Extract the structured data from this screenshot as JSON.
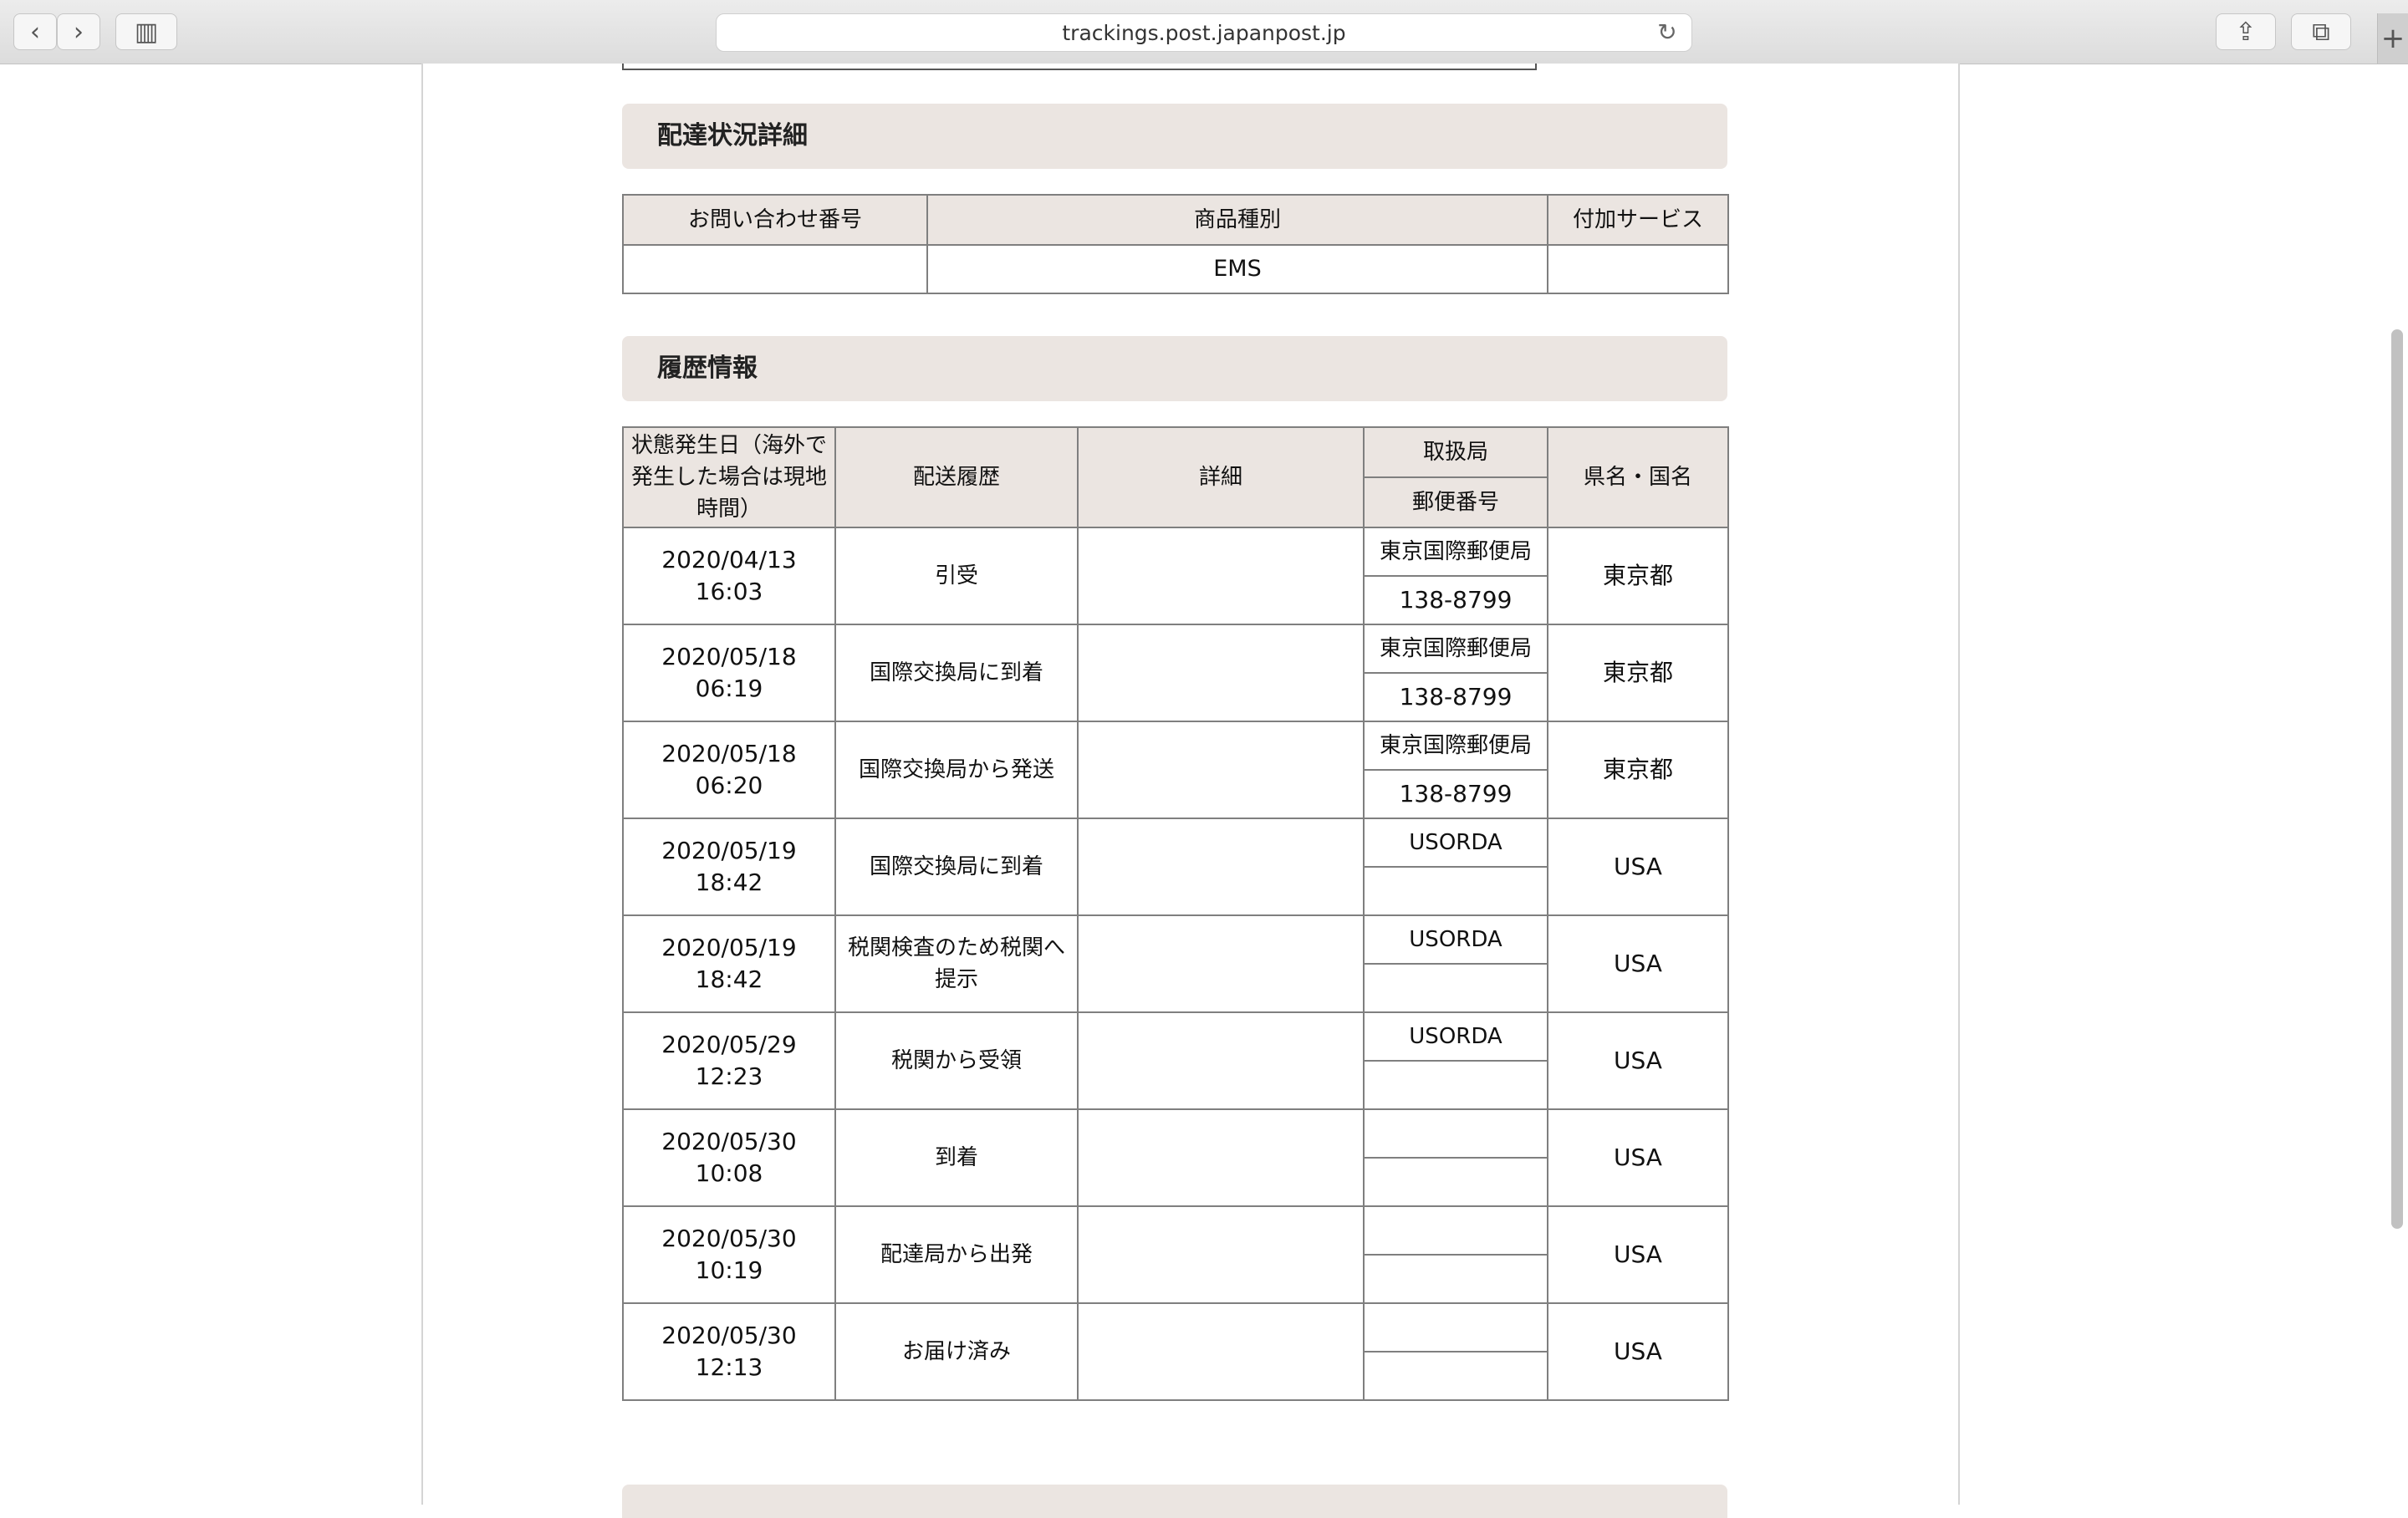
{
  "browser": {
    "url": "trackings.post.japanpost.jp",
    "back_icon": "‹",
    "forward_icon": "›",
    "sidebar_icon": "▥",
    "reload_icon": "↻",
    "share_icon": "⇪",
    "tabs_icon": "⧉",
    "newtab_icon": "+"
  },
  "delivery_status": {
    "heading": "配達状況詳細",
    "headers": [
      "お問い合わせ番号",
      "商品種別",
      "付加サービス"
    ],
    "row": [
      "",
      "EMS",
      ""
    ]
  },
  "history": {
    "heading": "履歴情報",
    "headers": {
      "date": "状態発生日（海外で発生した場合は現地時間）",
      "event": "配送履歴",
      "detail": "詳細",
      "office": "取扱局",
      "postal": "郵便番号",
      "region": "県名・国名"
    },
    "rows": [
      {
        "date": "2020/04/13",
        "time": "16:03",
        "event": "引受",
        "detail": "",
        "office": "東京国際郵便局",
        "postal": "138-8799",
        "region": "東京都"
      },
      {
        "date": "2020/05/18",
        "time": "06:19",
        "event": "国際交換局に到着",
        "detail": "",
        "office": "東京国際郵便局",
        "postal": "138-8799",
        "region": "東京都"
      },
      {
        "date": "2020/05/18",
        "time": "06:20",
        "event": "国際交換局から発送",
        "detail": "",
        "office": "東京国際郵便局",
        "postal": "138-8799",
        "region": "東京都"
      },
      {
        "date": "2020/05/19",
        "time": "18:42",
        "event": "国際交換局に到着",
        "detail": "",
        "office": "USORDA",
        "postal": "",
        "region": "USA"
      },
      {
        "date": "2020/05/19",
        "time": "18:42",
        "event": "税関検査のため税関へ提示",
        "detail": "",
        "office": "USORDA",
        "postal": "",
        "region": "USA"
      },
      {
        "date": "2020/05/29",
        "time": "12:23",
        "event": "税関から受領",
        "detail": "",
        "office": "USORDA",
        "postal": "",
        "region": "USA"
      },
      {
        "date": "2020/05/30",
        "time": "10:08",
        "event": "到着",
        "detail": "",
        "office": "",
        "postal": "",
        "region": "USA"
      },
      {
        "date": "2020/05/30",
        "time": "10:19",
        "event": "配達局から出発",
        "detail": "",
        "office": "",
        "postal": "",
        "region": "USA"
      },
      {
        "date": "2020/05/30",
        "time": "12:13",
        "event": "お届け済み",
        "detail": "",
        "office": "",
        "postal": "",
        "region": "USA"
      }
    ]
  }
}
